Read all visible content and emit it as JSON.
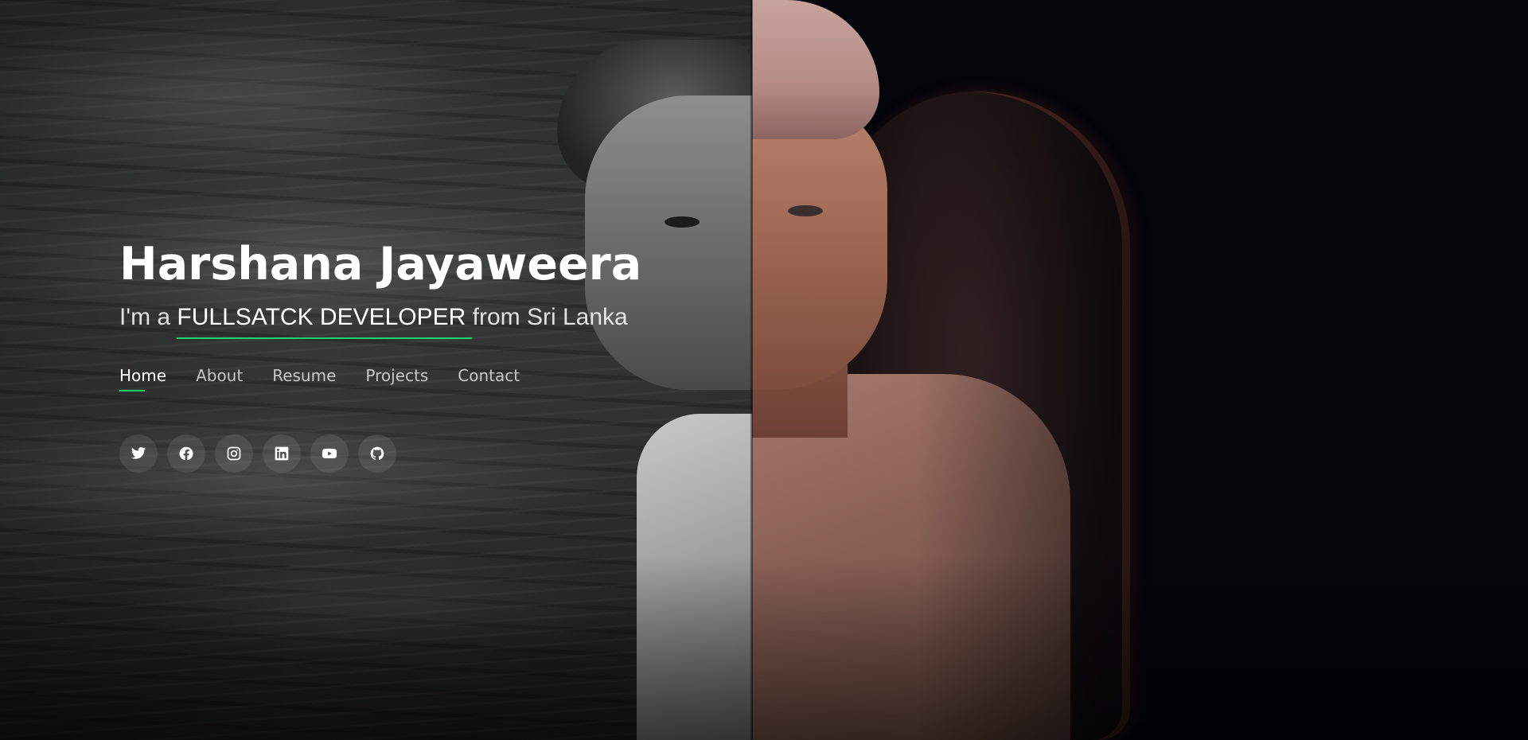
{
  "hero": {
    "name": "Harshana Jayaweera",
    "tagline_prefix": "I'm a ",
    "tagline_role": "FULLSATCK DEVELOPER",
    "tagline_suffix": " from Sri Lanka"
  },
  "nav": {
    "items": [
      {
        "label": "Home",
        "active": true
      },
      {
        "label": "About",
        "active": false
      },
      {
        "label": "Resume",
        "active": false
      },
      {
        "label": "Projects",
        "active": false
      },
      {
        "label": "Contact",
        "active": false
      }
    ]
  },
  "social": {
    "icons": [
      "twitter-icon",
      "facebook-icon",
      "instagram-icon",
      "linkedin-icon",
      "youtube-icon",
      "github-icon"
    ]
  },
  "colors": {
    "accent": "#18d26e",
    "text": "#ffffff",
    "background": "#040509"
  }
}
